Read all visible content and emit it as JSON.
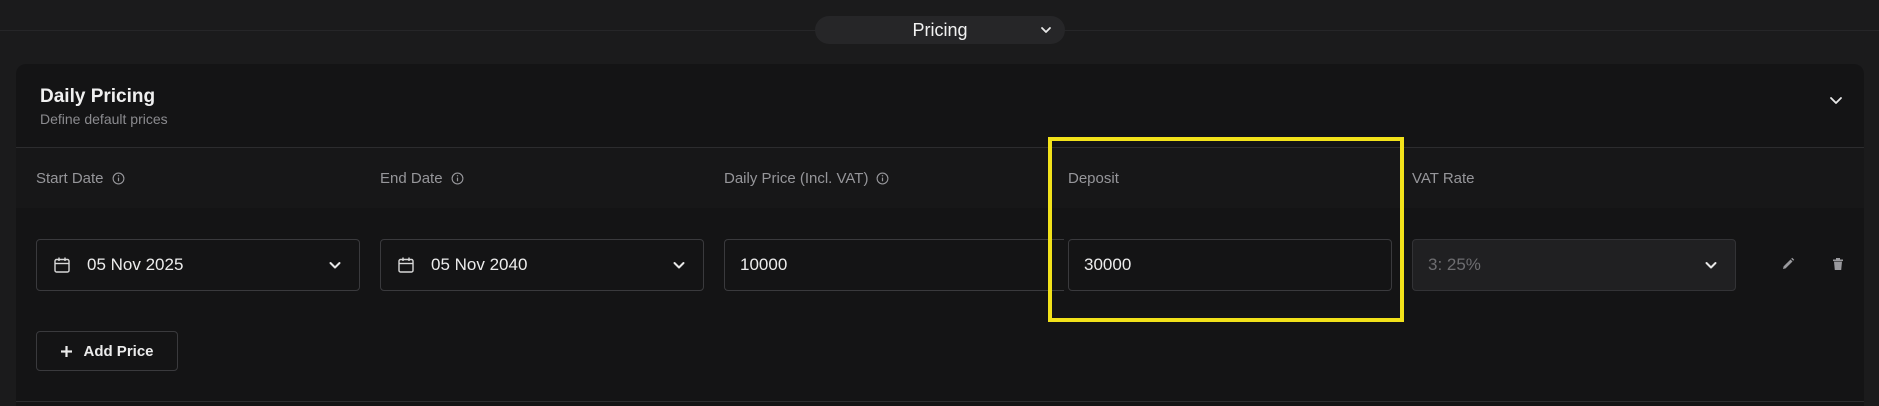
{
  "section_selector": {
    "label": "Pricing",
    "icon": "chevron-down-icon"
  },
  "card": {
    "title": "Daily Pricing",
    "subtitle": "Define default prices",
    "collapse_icon": "chevron-down-icon"
  },
  "columns": {
    "start_date": "Start Date",
    "end_date": "End Date",
    "daily_price": "Daily Price (Incl. VAT)",
    "deposit": "Deposit",
    "vat_rate": "VAT Rate"
  },
  "row": {
    "start_date": "05 Nov 2025",
    "end_date": "05 Nov 2040",
    "daily_price": "10000",
    "deposit": "30000",
    "vat_rate": "3: 25%"
  },
  "actions": {
    "edit_icon": "pencil-icon",
    "delete_icon": "trash-icon"
  },
  "add_price_label": "Add Price",
  "colors": {
    "highlight": "#f2e21a",
    "background": "#1b1b1c",
    "card": "#141415"
  }
}
